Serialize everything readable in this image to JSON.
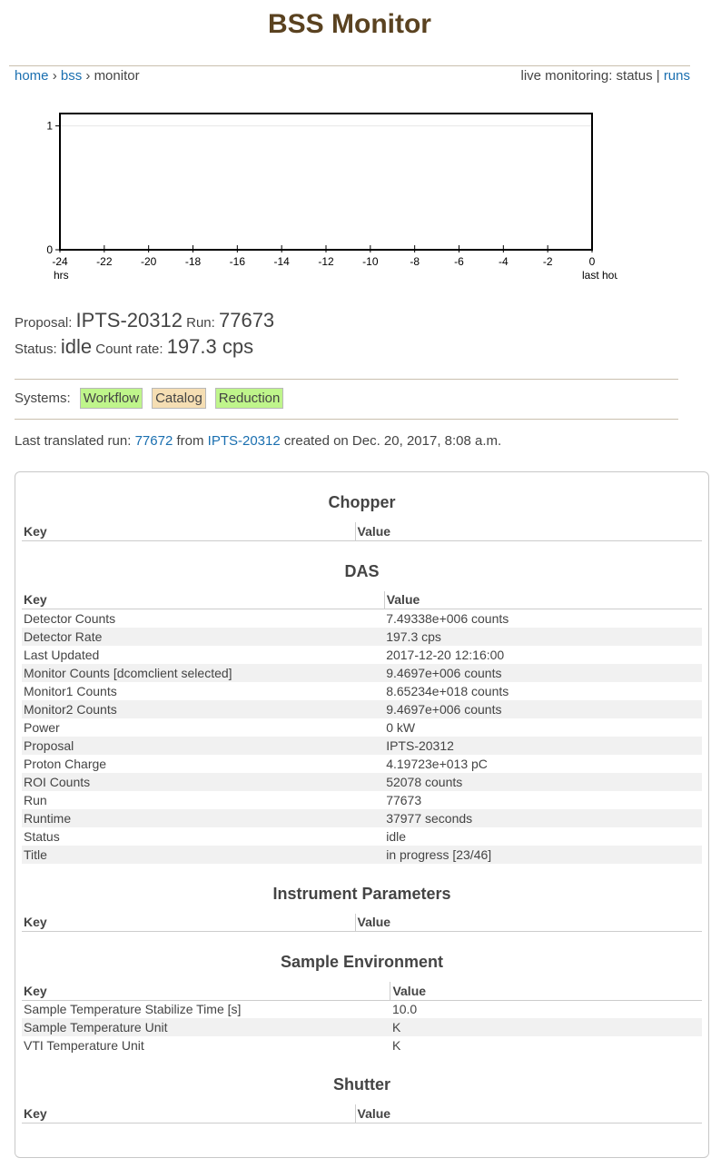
{
  "page": {
    "title": "BSS Monitor"
  },
  "breadcrumb": {
    "home": "home",
    "sep1": "›",
    "bss": "bss",
    "sep2": "›",
    "current": "monitor"
  },
  "live": {
    "prefix": "live monitoring: status |",
    "runs_link": "runs"
  },
  "chart_data": {
    "type": "line",
    "x_ticks": [
      "-24",
      "-22",
      "-20",
      "-18",
      "-16",
      "-14",
      "-12",
      "-10",
      "-8",
      "-6",
      "-4",
      "-2",
      "0"
    ],
    "y_ticks": [
      "0",
      "1"
    ],
    "xlim": [
      -24,
      0
    ],
    "ylim": [
      0,
      1.1
    ],
    "grid": true,
    "x_left_label": "hrs",
    "x_right_label": "last hour",
    "series": []
  },
  "run_info": {
    "proposal_label": "Proposal:",
    "proposal": "IPTS-20312",
    "run_label": "Run:",
    "run": "77673",
    "status_label": "Status:",
    "status": "idle",
    "rate_label": "Count rate:",
    "rate": "197.3 cps"
  },
  "systems": {
    "label": "Systems:",
    "items": [
      {
        "name": "Workflow",
        "state": "ok",
        "color": "#bff58b"
      },
      {
        "name": "Catalog",
        "state": "warn",
        "color": "#f5deb3"
      },
      {
        "name": "Reduction",
        "state": "ok",
        "color": "#bff58b"
      }
    ]
  },
  "last_run": {
    "prefix": "Last translated run:",
    "run": "77672",
    "from": "from",
    "proposal": "IPTS-20312",
    "suffix": "created on Dec. 20, 2017, 8:08 a.m."
  },
  "sections": [
    {
      "title": "Chopper",
      "key_header": "Key",
      "value_header": "Value",
      "key_col": "49%",
      "rows": []
    },
    {
      "title": "DAS",
      "key_header": "Key",
      "value_header": "Value",
      "key_col": "53.3%",
      "rows": [
        [
          "Detector Counts",
          "7.49338e+006 counts"
        ],
        [
          "Detector Rate",
          "197.3 cps"
        ],
        [
          "Last Updated",
          "2017-12-20 12:16:00"
        ],
        [
          "Monitor Counts [dcomclient selected]",
          "9.4697e+006 counts"
        ],
        [
          "Monitor1 Counts",
          "8.65234e+018 counts"
        ],
        [
          "Monitor2 Counts",
          "9.4697e+006 counts"
        ],
        [
          "Power",
          "0 kW"
        ],
        [
          "Proposal",
          "IPTS-20312"
        ],
        [
          "Proton Charge",
          "4.19723e+013 pC"
        ],
        [
          "ROI Counts",
          "52078 counts"
        ],
        [
          "Run",
          "77673"
        ],
        [
          "Runtime",
          "37977 seconds"
        ],
        [
          "Status",
          "idle"
        ],
        [
          "Title",
          "in progress [23/46]"
        ]
      ]
    },
    {
      "title": "Instrument Parameters",
      "key_header": "Key",
      "value_header": "Value",
      "key_col": "49%",
      "rows": []
    },
    {
      "title": "Sample Environment",
      "key_header": "Key",
      "value_header": "Value",
      "key_col": "54.2%",
      "rows": [
        [
          "Sample Temperature Stabilize Time [s]",
          "10.0"
        ],
        [
          "Sample Temperature Unit",
          "K"
        ],
        [
          "VTI Temperature Unit",
          "K"
        ]
      ]
    },
    {
      "title": "Shutter",
      "key_header": "Key",
      "value_header": "Value",
      "key_col": "49%",
      "rows": []
    }
  ]
}
